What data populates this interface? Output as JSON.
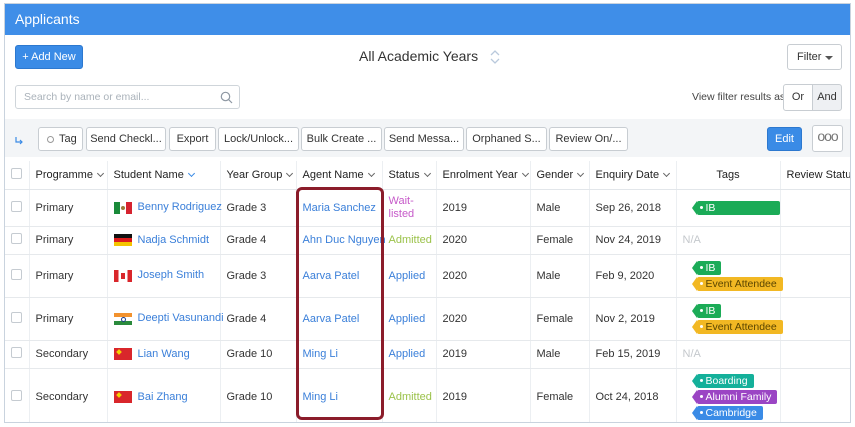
{
  "header": {
    "title": "Applicants"
  },
  "toolbar_top": {
    "add_new_label": "+ Add New",
    "year_title": "All Academic Years",
    "filter_label": "Filter"
  },
  "search": {
    "placeholder": "Search by name or email..."
  },
  "view_filter": {
    "label": "View filter results as:",
    "or_label": "Or",
    "and_label": "And"
  },
  "actions": {
    "tag_label": "Tag",
    "buttons": [
      "Send Checkl...",
      "Export",
      "Lock/Unlock...",
      "Bulk Create ...",
      "Send Messa...",
      "Orphaned S...",
      "Review On/..."
    ],
    "edit_label": "Edit",
    "more_label": "ooo"
  },
  "table": {
    "columns": [
      "Programme",
      "Student Name",
      "Year Group",
      "Agent Name",
      "Status",
      "Enrolment Year",
      "Gender",
      "Enquiry Date",
      "Tags",
      "Review Status"
    ],
    "rows": [
      {
        "programme": "Primary",
        "flag": "mexico-flag",
        "name": "Benny Rodriguez",
        "year_group": "Grade 3",
        "agent": "Maria Sanchez",
        "status": "Wait-listed",
        "status_kind": "wait",
        "enrolment_year": "2019",
        "gender": "Male",
        "enquiry_date": "Sep 26, 2018",
        "tags": [
          {
            "label": "IB",
            "color": "#1bab57"
          }
        ],
        "review_status": ""
      },
      {
        "programme": "Primary",
        "flag": "germany-flag",
        "name": "Nadja Schmidt",
        "year_group": "Grade 4",
        "agent": "Ahn Duc Nguyen",
        "status": "Admitted",
        "status_kind": "admit",
        "enrolment_year": "2020",
        "gender": "Female",
        "enquiry_date": "Nov 24, 2019",
        "tags_na": "N/A",
        "tags": [],
        "review_status": ""
      },
      {
        "programme": "Primary",
        "flag": "canada-flag",
        "name": "Joseph Smith",
        "year_group": "Grade 3",
        "agent": "Aarva Patel",
        "status": "Applied",
        "status_kind": "apply",
        "enrolment_year": "2020",
        "gender": "Male",
        "enquiry_date": "Feb 9, 2020",
        "tags": [
          {
            "label": "IB",
            "color": "#1bab57"
          },
          {
            "label": "Event Attendee",
            "color": "#f2b823"
          }
        ],
        "review_status": ""
      },
      {
        "programme": "Primary",
        "flag": "india-flag",
        "name": "Deepti Vasunandi",
        "year_group": "Grade 4",
        "agent": "Aarva Patel",
        "status": "Applied",
        "status_kind": "apply",
        "enrolment_year": "2020",
        "gender": "Female",
        "enquiry_date": "Nov 2, 2019",
        "tags": [
          {
            "label": "IB",
            "color": "#1bab57"
          },
          {
            "label": "Event Attendee",
            "color": "#f2b823"
          }
        ],
        "review_status": ""
      },
      {
        "programme": "Secondary",
        "flag": "china-flag",
        "name": "Lian Wang",
        "year_group": "Grade 10",
        "agent": "Ming Li",
        "status": "Applied",
        "status_kind": "apply",
        "enrolment_year": "2019",
        "gender": "Male",
        "enquiry_date": "Feb 15, 2019",
        "tags_na": "N/A",
        "tags": [],
        "review_status": ""
      },
      {
        "programme": "Secondary",
        "flag": "china-flag",
        "name": "Bai Zhang",
        "year_group": "Grade 10",
        "agent": "Ming Li",
        "status": "Admitted",
        "status_kind": "admit",
        "enrolment_year": "2019",
        "gender": "Female",
        "enquiry_date": "Oct 24, 2018",
        "tags": [
          {
            "label": "Boarding",
            "color": "#14b09a"
          },
          {
            "label": "Alumni Family",
            "color": "#9b45c4"
          },
          {
            "label": "Cambridge",
            "color": "#3a8be6"
          }
        ],
        "review_status": ""
      }
    ]
  },
  "colors": {
    "accent": "#3a8be6",
    "header_bar": "#3f8ee8",
    "highlight": "#8b1c2a"
  }
}
